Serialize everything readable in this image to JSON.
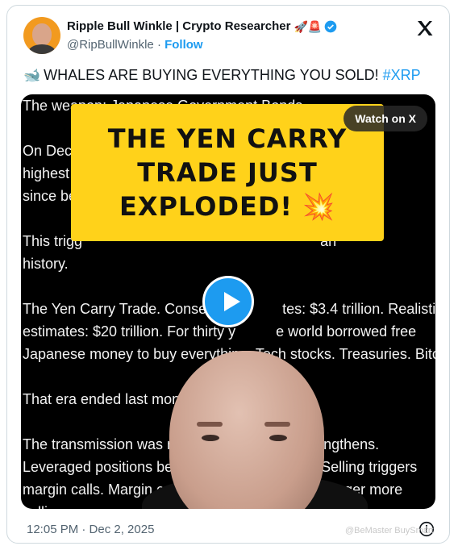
{
  "author": {
    "name": "Ripple Bull Winkle | Crypto Researcher",
    "name_emojis": "🚀🚨",
    "handle": "@RipBullWinkle",
    "separator": "·",
    "follow_label": "Follow"
  },
  "tweet": {
    "emoji": "🐋",
    "text": "WHALES ARE BUYING EVERYTHING YOU SOLD!",
    "hashtag": "#XRP"
  },
  "media": {
    "watch_label": "Watch on X",
    "banner_lines": [
      "THE YEN CARRY",
      "TRADE JUST",
      "EXPLODED! 💥"
    ],
    "background_text": "The weapon: Japanese Government Bonds.\n\nOn Dece                                                              e\nhighest s                                                            ot seen\nsince be\n\nThis trigg                                                           an\nhistory.\n\nThe Yen Carry Trade. Conservati            tes: $3.4 trillion. Realistic\nestimates: $20 trillion. For thirty y          e world borrowed free\nJapanese money to buy everything. Tech stocks. Treasuries. Bitcoin.\n\nThat era ended last month.\n\nThe transmission was mech                              ngthens.\nLeveraged positions bec                                 . Selling triggers\nmargin calls. Margin ca                                 ns trigger more\nselling."
  },
  "footer": {
    "timestamp": "12:05 PM · Dec 2, 2025",
    "watermark": "@BeMaster BuySmart"
  },
  "colors": {
    "accent": "#1d9bf0",
    "banner": "#ffd21a",
    "muted": "#536471"
  }
}
